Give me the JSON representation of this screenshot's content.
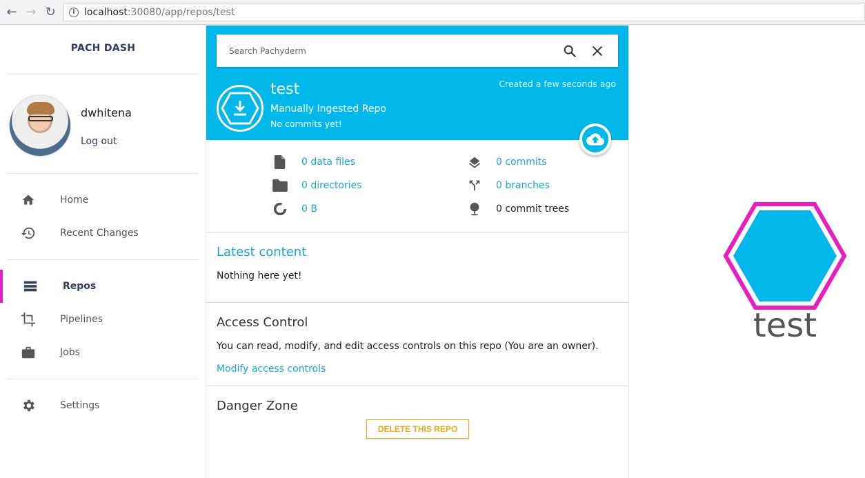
{
  "browser": {
    "url_host": "localhost",
    "url_rest": ":30080/app/repos/test"
  },
  "sidebar": {
    "brand": "PACH DASH",
    "user": {
      "name": "dwhitena",
      "logout_label": "Log out"
    },
    "items": [
      {
        "label": "Home",
        "icon": "home-icon"
      },
      {
        "label": "Recent Changes",
        "icon": "history-icon"
      },
      {
        "label": "Repos",
        "icon": "list-icon",
        "active": true
      },
      {
        "label": "Pipelines",
        "icon": "crop-icon"
      },
      {
        "label": "Jobs",
        "icon": "briefcase-icon"
      },
      {
        "label": "Settings",
        "icon": "gear-icon"
      }
    ]
  },
  "search": {
    "placeholder": "Search Pachyderm"
  },
  "repo": {
    "name": "test",
    "type": "Manually Ingested Repo",
    "commits_status": "No commits yet!",
    "created": "Created a few seconds ago"
  },
  "stats": {
    "data_files": "0 data files",
    "directories": "0 directories",
    "size": "0 B",
    "commits": "0 commits",
    "branches": "0 branches",
    "commit_trees": "0 commit trees"
  },
  "latest": {
    "title": "Latest content",
    "text": "Nothing here yet!"
  },
  "access": {
    "title": "Access Control",
    "text": "You can read, modify, and edit access controls on this repo (You are an owner).",
    "link": "Modify access controls"
  },
  "danger": {
    "title": "Danger Zone",
    "button": "DELETE THIS REPO"
  },
  "visual": {
    "caption": "test"
  },
  "colors": {
    "accent": "#00b7ea",
    "brand": "#2f3f5f",
    "active": "#e91ebf",
    "warning": "#e6a91a",
    "link": "#1aa6d8"
  }
}
